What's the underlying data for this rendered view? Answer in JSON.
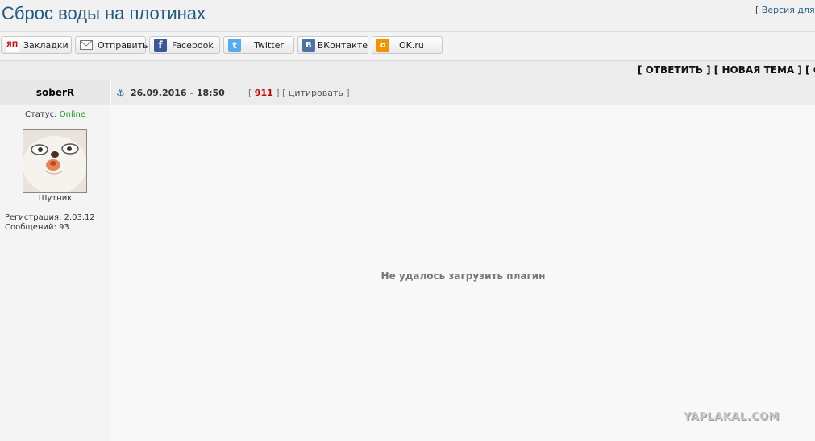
{
  "page": {
    "title": "Сброс воды на плотинах",
    "version_bracket": "[",
    "version_link": "Версия для"
  },
  "share": [
    {
      "label": "Закладки",
      "icon": "yap-icon",
      "color": "#ffffff"
    },
    {
      "label": "Отправить",
      "icon": "mail-icon",
      "color": "#ffffff"
    },
    {
      "label": "Facebook",
      "icon": "facebook-icon",
      "color": "#3b5998"
    },
    {
      "label": "Twitter",
      "icon": "twitter-icon",
      "color": "#55acee"
    },
    {
      "label": "ВКонтакте",
      "icon": "vk-icon",
      "color": "#4c75a3"
    },
    {
      "label": "OK.ru",
      "icon": "ok-icon",
      "color": "#f29400"
    }
  ],
  "actions": {
    "open": "[ ",
    "reply": "ОТВЕТИТЬ",
    "sep": " ] [ ",
    "new_topic": "НОВАЯ ТЕМА",
    "tail": " ] [ С"
  },
  "post": {
    "username": "soberR",
    "date": "26.09.2016 - 18:50",
    "lb1": "[ ",
    "number": "911",
    "mid": " ] [ ",
    "quote": "цитировать",
    "rb": " ]"
  },
  "profile": {
    "status_label": "Статус: ",
    "status_value": "Online",
    "rank": "Шутник",
    "registration": "Регистрация: 2.03.12",
    "messages": "Сообщений: 93"
  },
  "content": {
    "plugin_error": "Не удалось загрузить плагин"
  },
  "watermark": "YAPLAKAL.COM"
}
